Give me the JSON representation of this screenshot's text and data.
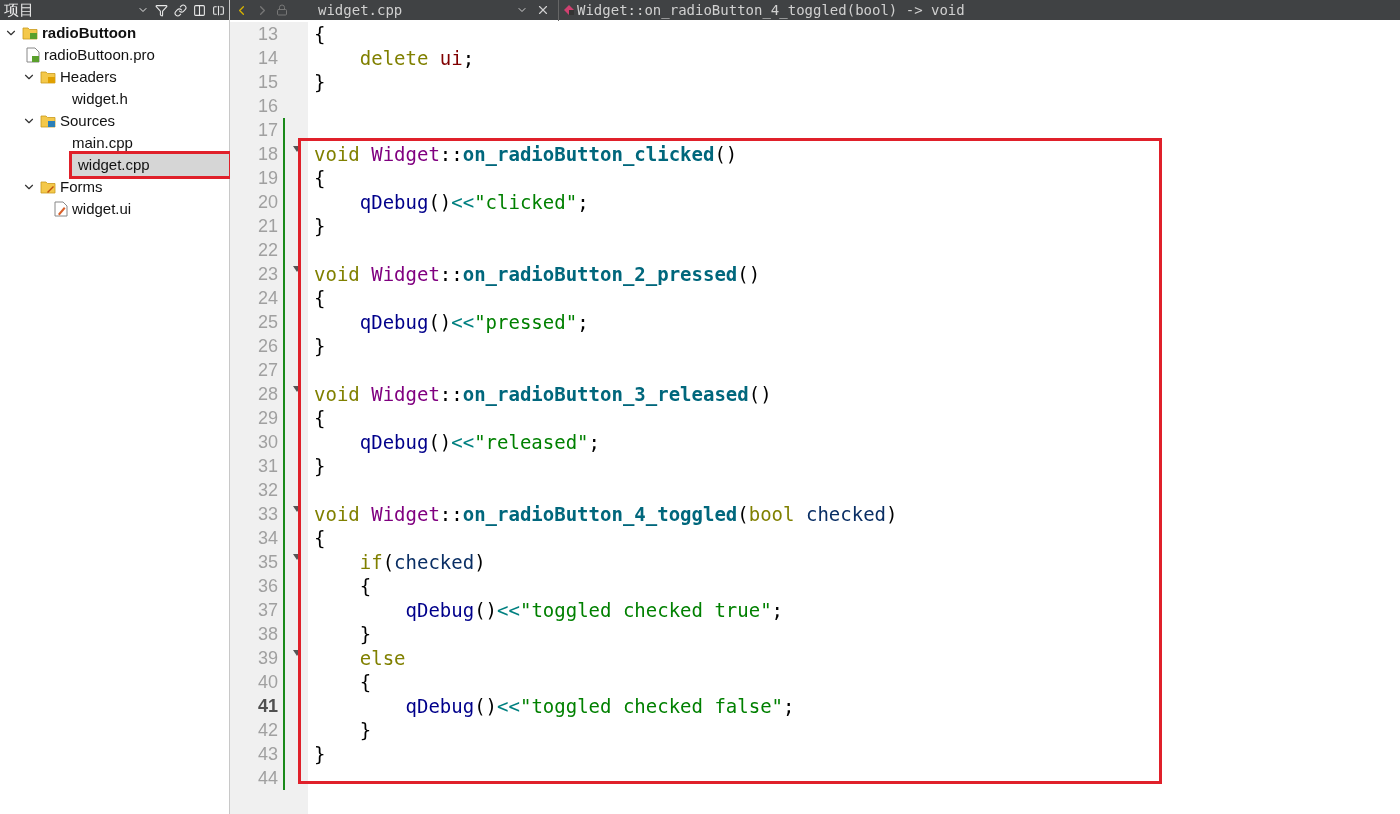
{
  "project_panel": {
    "title": "项目",
    "tree": [
      {
        "label": "radioButtoon",
        "kind": "project",
        "expanded": true,
        "selected": false,
        "annotated": false,
        "children": [
          {
            "label": "radioButtoon.pro",
            "kind": "profile",
            "selected": false,
            "annotated": false
          },
          {
            "label": "Headers",
            "kind": "headers",
            "expanded": true,
            "selected": false,
            "annotated": false,
            "children": [
              {
                "label": "widget.h",
                "kind": "file",
                "selected": false,
                "annotated": false
              }
            ]
          },
          {
            "label": "Sources",
            "kind": "sources",
            "expanded": true,
            "selected": false,
            "annotated": false,
            "children": [
              {
                "label": "main.cpp",
                "kind": "file",
                "selected": false,
                "annotated": false
              },
              {
                "label": "widget.cpp",
                "kind": "file",
                "selected": true,
                "annotated": true
              }
            ]
          },
          {
            "label": "Forms",
            "kind": "forms",
            "expanded": true,
            "selected": false,
            "annotated": false,
            "children": [
              {
                "label": "widget.ui",
                "kind": "uifile",
                "selected": false,
                "annotated": false
              }
            ]
          }
        ]
      }
    ]
  },
  "editor": {
    "file": "widget.cpp",
    "symbol": "Widget::on_radioButton_4_toggled(bool) -> void",
    "blocks": [
      {
        "annotated": false,
        "lines": [
          {
            "number": "13",
            "fold": false,
            "modified": false,
            "current": false,
            "tokens": [
              {
                "kind": "plain",
                "text": "{"
              }
            ]
          },
          {
            "number": "14",
            "fold": false,
            "modified": false,
            "current": false,
            "tokens": [
              {
                "kind": "kw",
                "text": "    delete "
              },
              {
                "kind": "member",
                "text": "ui"
              },
              {
                "kind": "plain",
                "text": ";"
              }
            ]
          },
          {
            "number": "15",
            "fold": false,
            "modified": false,
            "current": false,
            "tokens": [
              {
                "kind": "plain",
                "text": "}"
              }
            ]
          },
          {
            "number": "16",
            "fold": false,
            "modified": false,
            "current": false
          },
          {
            "number": "17",
            "fold": false,
            "modified": true,
            "current": false
          }
        ]
      },
      {
        "annotated": true,
        "lines": [
          {
            "number": "18",
            "fold": true,
            "modified": true,
            "current": false,
            "tokens": [
              {
                "kind": "kw",
                "text": "void "
              },
              {
                "kind": "class",
                "text": "Widget"
              },
              {
                "kind": "plain",
                "text": "::"
              },
              {
                "kind": "func",
                "text": "on_radioButton_clicked"
              },
              {
                "kind": "plain",
                "text": "()"
              }
            ]
          },
          {
            "number": "19",
            "fold": false,
            "modified": true,
            "current": false,
            "tokens": [
              {
                "kind": "plain",
                "text": "{"
              }
            ]
          },
          {
            "number": "20",
            "fold": false,
            "modified": true,
            "current": false,
            "tokens": [
              {
                "kind": "call",
                "text": "    qDebug"
              },
              {
                "kind": "plain",
                "text": "()"
              },
              {
                "kind": "op",
                "text": "<<"
              },
              {
                "kind": "string",
                "text": "\"clicked\""
              },
              {
                "kind": "plain",
                "text": ";"
              }
            ]
          },
          {
            "number": "21",
            "fold": false,
            "modified": true,
            "current": false,
            "tokens": [
              {
                "kind": "plain",
                "text": "}"
              }
            ]
          },
          {
            "number": "22",
            "fold": false,
            "modified": true,
            "current": false
          },
          {
            "number": "23",
            "fold": true,
            "modified": true,
            "current": false,
            "tokens": [
              {
                "kind": "kw",
                "text": "void "
              },
              {
                "kind": "class",
                "text": "Widget"
              },
              {
                "kind": "plain",
                "text": "::"
              },
              {
                "kind": "func",
                "text": "on_radioButton_2_pressed"
              },
              {
                "kind": "plain",
                "text": "()"
              }
            ]
          },
          {
            "number": "24",
            "fold": false,
            "modified": true,
            "current": false,
            "tokens": [
              {
                "kind": "plain",
                "text": "{"
              }
            ]
          },
          {
            "number": "25",
            "fold": false,
            "modified": true,
            "current": false,
            "tokens": [
              {
                "kind": "call",
                "text": "    qDebug"
              },
              {
                "kind": "plain",
                "text": "()"
              },
              {
                "kind": "op",
                "text": "<<"
              },
              {
                "kind": "string",
                "text": "\"pressed\""
              },
              {
                "kind": "plain",
                "text": ";"
              }
            ]
          },
          {
            "number": "26",
            "fold": false,
            "modified": true,
            "current": false,
            "tokens": [
              {
                "kind": "plain",
                "text": "}"
              }
            ]
          },
          {
            "number": "27",
            "fold": false,
            "modified": true,
            "current": false
          },
          {
            "number": "28",
            "fold": true,
            "modified": true,
            "current": false,
            "tokens": [
              {
                "kind": "kw",
                "text": "void "
              },
              {
                "kind": "class",
                "text": "Widget"
              },
              {
                "kind": "plain",
                "text": "::"
              },
              {
                "kind": "func",
                "text": "on_radioButton_3_released"
              },
              {
                "kind": "plain",
                "text": "()"
              }
            ]
          },
          {
            "number": "29",
            "fold": false,
            "modified": true,
            "current": false,
            "tokens": [
              {
                "kind": "plain",
                "text": "{"
              }
            ]
          },
          {
            "number": "30",
            "fold": false,
            "modified": true,
            "current": false,
            "tokens": [
              {
                "kind": "call",
                "text": "    qDebug"
              },
              {
                "kind": "plain",
                "text": "()"
              },
              {
                "kind": "op",
                "text": "<<"
              },
              {
                "kind": "string",
                "text": "\"released\""
              },
              {
                "kind": "plain",
                "text": ";"
              }
            ]
          },
          {
            "number": "31",
            "fold": false,
            "modified": true,
            "current": false,
            "tokens": [
              {
                "kind": "plain",
                "text": "}"
              }
            ]
          },
          {
            "number": "32",
            "fold": false,
            "modified": true,
            "current": false
          },
          {
            "number": "33",
            "fold": true,
            "modified": true,
            "current": false,
            "tokens": [
              {
                "kind": "kw",
                "text": "void "
              },
              {
                "kind": "class",
                "text": "Widget"
              },
              {
                "kind": "plain",
                "text": "::"
              },
              {
                "kind": "func",
                "text": "on_radioButton_4_toggled"
              },
              {
                "kind": "plain",
                "text": "("
              },
              {
                "kind": "kw",
                "text": "bool "
              },
              {
                "kind": "param",
                "text": "checked"
              },
              {
                "kind": "plain",
                "text": ")"
              }
            ]
          },
          {
            "number": "34",
            "fold": false,
            "modified": true,
            "current": false,
            "tokens": [
              {
                "kind": "plain",
                "text": "{"
              }
            ]
          },
          {
            "number": "35",
            "fold": true,
            "modified": true,
            "current": false,
            "tokens": [
              {
                "kind": "kw",
                "text": "    if"
              },
              {
                "kind": "plain",
                "text": "("
              },
              {
                "kind": "param",
                "text": "checked"
              },
              {
                "kind": "plain",
                "text": ")"
              }
            ]
          },
          {
            "number": "36",
            "fold": false,
            "modified": true,
            "current": false,
            "tokens": [
              {
                "kind": "plain",
                "text": "    {"
              }
            ]
          },
          {
            "number": "37",
            "fold": false,
            "modified": true,
            "current": false,
            "tokens": [
              {
                "kind": "call",
                "text": "        qDebug"
              },
              {
                "kind": "plain",
                "text": "()"
              },
              {
                "kind": "op",
                "text": "<<"
              },
              {
                "kind": "string",
                "text": "\"toggled checked true\""
              },
              {
                "kind": "plain",
                "text": ";"
              }
            ]
          },
          {
            "number": "38",
            "fold": false,
            "modified": true,
            "current": false,
            "tokens": [
              {
                "kind": "plain",
                "text": "    }"
              }
            ]
          },
          {
            "number": "39",
            "fold": true,
            "modified": true,
            "current": false,
            "tokens": [
              {
                "kind": "kw",
                "text": "    else"
              }
            ]
          },
          {
            "number": "40",
            "fold": false,
            "modified": true,
            "current": false,
            "tokens": [
              {
                "kind": "plain",
                "text": "    {"
              }
            ]
          },
          {
            "number": "41",
            "fold": false,
            "modified": true,
            "current": true,
            "tokens": [
              {
                "kind": "call",
                "text": "        qDebug"
              },
              {
                "kind": "plain",
                "text": "()"
              },
              {
                "kind": "op",
                "text": "<<"
              },
              {
                "kind": "string",
                "text": "\"toggled checked false\""
              },
              {
                "kind": "plain",
                "text": ";"
              }
            ]
          },
          {
            "number": "42",
            "fold": false,
            "modified": true,
            "current": false,
            "tokens": [
              {
                "kind": "plain",
                "text": "    }"
              }
            ]
          },
          {
            "number": "43",
            "fold": false,
            "modified": true,
            "current": false,
            "tokens": [
              {
                "kind": "plain",
                "text": "}"
              }
            ]
          },
          {
            "number": "44",
            "fold": false,
            "modified": true,
            "current": false
          }
        ]
      }
    ]
  }
}
